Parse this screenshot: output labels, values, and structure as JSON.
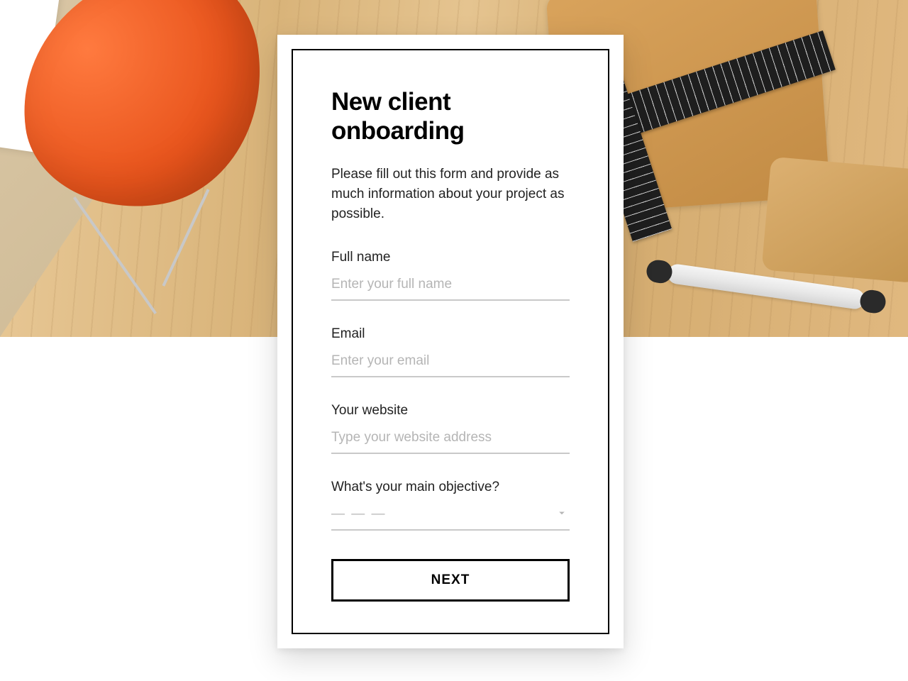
{
  "form": {
    "title": "New client onboarding",
    "description": "Please fill out this form and provide as much information about your project as possible.",
    "fields": {
      "full_name": {
        "label": "Full name",
        "placeholder": "Enter your full name",
        "value": ""
      },
      "email": {
        "label": "Email",
        "placeholder": "Enter your email",
        "value": ""
      },
      "website": {
        "label": "Your website",
        "placeholder": "Type your website address",
        "value": ""
      },
      "objective": {
        "label": "What's your main objective?",
        "placeholder": "— — —",
        "value": ""
      }
    },
    "submit_label": "NEXT"
  }
}
